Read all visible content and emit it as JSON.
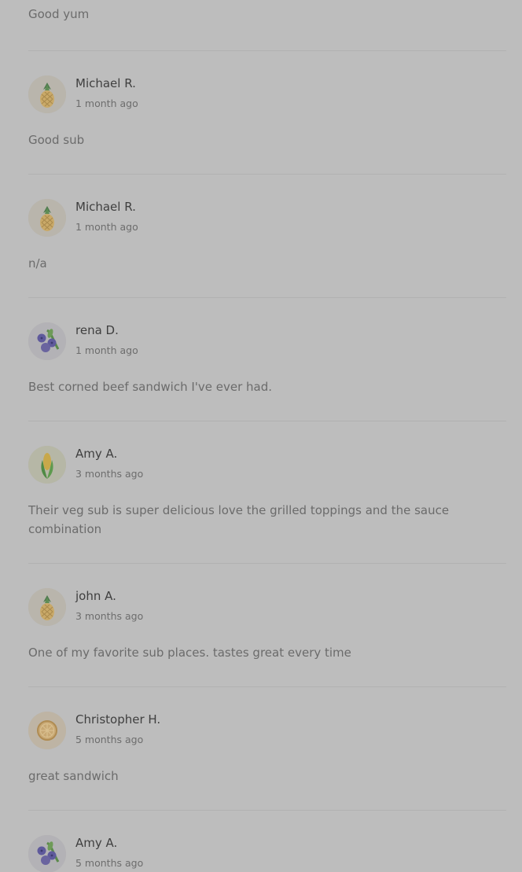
{
  "top_partial": {
    "text": "Good yum"
  },
  "reviews": [
    {
      "name": "Michael R.",
      "time": "1 month ago",
      "text": "Good sub",
      "avatar": "pineapple-icon"
    },
    {
      "name": "Michael R.",
      "time": "1 month ago",
      "text": "n/a",
      "avatar": "pineapple-icon"
    },
    {
      "name": "rena D.",
      "time": "1 month ago",
      "text": "Best corned beef sandwich I've ever had.",
      "avatar": "blueberry-icon"
    },
    {
      "name": "Amy A.",
      "time": "3 months ago",
      "text": "Their veg sub is super delicious love the grilled toppings and the sauce combination",
      "avatar": "corn-icon"
    },
    {
      "name": "john A.",
      "time": "3 months ago",
      "text": "One of my favorite sub places. tastes great every time",
      "avatar": "pineapple-icon"
    },
    {
      "name": "Christopher H.",
      "time": "5 months ago",
      "text": "great sandwich",
      "avatar": "citrus-slice-icon"
    },
    {
      "name": "Amy A.",
      "time": "5 months ago",
      "text": "",
      "avatar": "blueberry-icon"
    }
  ]
}
